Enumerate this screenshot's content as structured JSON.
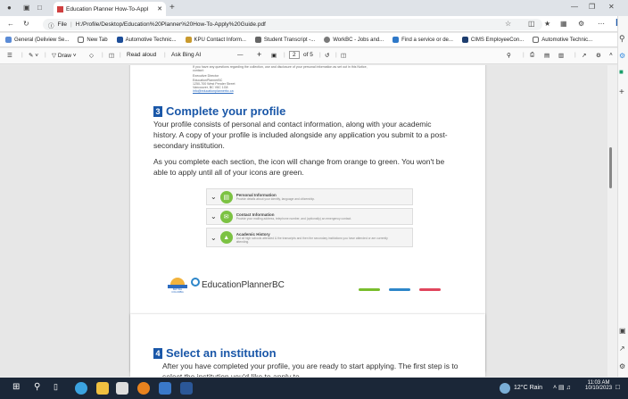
{
  "browser": {
    "tab_title": "Education Planner How-To-Appl",
    "url_prefix": "File",
    "url": "H:/Profile/Desktop/Education%20Planner%20How-To-Apply%20Guide.pdf",
    "favorites": [
      "General (Deliview Se...",
      "New Tab",
      "Automotive Technic...",
      "KPU Contact Inform...",
      "Student Transcript -...",
      "WorkBC - Jobs and...",
      "Find a service or de...",
      "CIMS EmployeeCon...",
      "Automotive Technic..."
    ]
  },
  "pdf_toolbar": {
    "draw": "Draw",
    "read_aloud": "Read aloud",
    "ask_bing": "Ask Bing AI",
    "page_current": "2",
    "page_total": "of 5",
    "zoom_minus": "—",
    "zoom_plus": "+"
  },
  "page1": {
    "contact_lines": [
      "If you have any questions regarding the collection, use and disclosure of your personal information as set out in this Notice,",
      "contact:",
      "Executive Director",
      "EducationPlannerBC",
      "1250-700 West Pender Street",
      "Vancouver, BC V6C 1G8",
      "info@educationplannerbc.ca"
    ],
    "section_number": "3",
    "section_title": "Complete your profile",
    "para1": "Your profile consists of personal and contact information, along with your academic history. A copy of your profile is included alongside any application you submit to a post-secondary institution.",
    "para2": "As you complete each section, the icon will change from orange to green. You won't be able to apply until all of your icons are green.",
    "cards": [
      {
        "title": "Personal Information",
        "desc": "Provide details about your identity, language and citizenship."
      },
      {
        "title": "Contact Information",
        "desc": "Provide your mailing address, telephone number, and (optionally) an emergency contact."
      },
      {
        "title": "Academic History",
        "desc": "List all high schools attended & the transcripts and then the secondary institutions you have attended or are currently attending."
      }
    ],
    "logo_text": "EducationPlannerBC",
    "bc_text": "BRITISH COLUMBIA"
  },
  "page2": {
    "section_number": "4",
    "section_title": "Select an institution",
    "para1": "After you have completed your profile, you are ready to start applying. The first step is to select the institution you'd like to apply to."
  },
  "taskbar": {
    "weather": "12°C Rain",
    "time": "11:03 AM",
    "date": "10/10/2023"
  },
  "colors": {
    "accent": "#1a57a8",
    "green": "#7cc243",
    "bar_green": "#79bd2c",
    "bar_blue": "#2d86c9",
    "bar_red": "#e0455c"
  }
}
